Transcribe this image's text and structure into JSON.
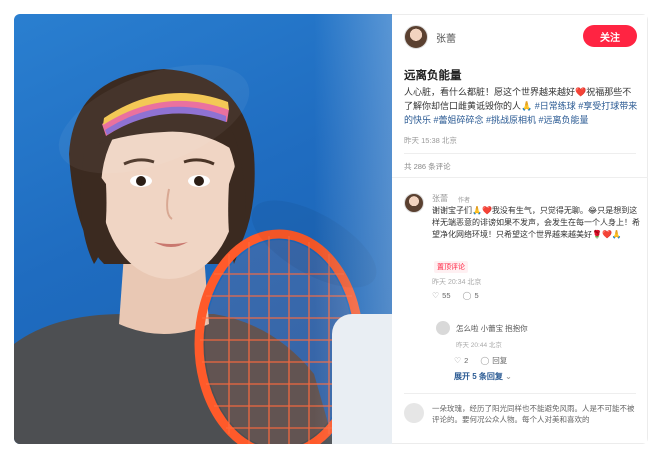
{
  "post": {
    "author": "张蕾",
    "follow_label": "关注",
    "title": "远离负能量",
    "body": "人心脏，看什么都脏！愿这个世界越来越好❤️祝福那些不了解你却信口雌黄诋毁你的人🙏",
    "tags": "#日常练球 #享受打球带来的快乐 #蕾姐碎碎念 #挑战原相机 #远离负能量",
    "time": "昨天 15:38 北京",
    "comment_count": "共 286 条评论"
  },
  "comment1": {
    "author": "张蕾",
    "badge": "作者",
    "text": "谢谢宝子们🙏❤️我没有生气，只觉得无聊。😂只是想到这样无端恶意的诽谤如果不发声，会发生在每一个人身上！希望净化网络环境！只希望这个世界越来越美好🌹❤️🙏",
    "pinned_label": "置顶评论",
    "time": "昨天 20:34 北京",
    "likes": "55",
    "replies": "5"
  },
  "reply1": {
    "text": "怎么啦 小蕾宝 抱抱你",
    "time": "昨天 20:44 北京",
    "likes": "2",
    "reply_label": "回复",
    "expand_label": "展开 5 条回复"
  },
  "comment2": {
    "text": "一朵玫瑰，经历了阳光同样也不能避免风雨。人是不可能不被评论的。要何况公众人物。每个人对美和喜欢的"
  },
  "icons": {
    "like": "heart-icon",
    "comment": "comment-icon",
    "chevron": "chevron-down-icon"
  },
  "colors": {
    "accent": "#ff2442",
    "tag": "#2a5a93",
    "background": "#1f6cc0"
  }
}
